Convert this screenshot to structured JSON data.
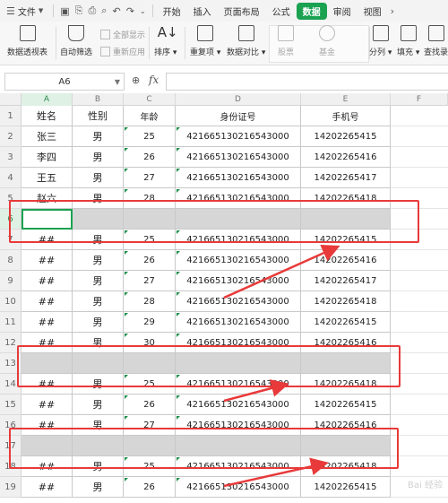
{
  "menubar": {
    "file_label": "文件",
    "tabs": [
      {
        "label": "开始",
        "active": false
      },
      {
        "label": "插入",
        "active": false
      },
      {
        "label": "页面布局",
        "active": false
      },
      {
        "label": "公式",
        "active": false
      },
      {
        "label": "数据",
        "active": true
      },
      {
        "label": "审阅",
        "active": false
      },
      {
        "label": "视图",
        "active": false
      }
    ]
  },
  "ribbon": {
    "pivot": "数据透视表",
    "autofilter": "自动筛选",
    "show_all": "全部显示",
    "reapply": "重新应用",
    "sort": "排序",
    "duplicates": "重复项",
    "compare": "数据对比",
    "stocks": "股票",
    "funds": "基金",
    "split": "分列",
    "fill": "填充",
    "find_record": "查找录"
  },
  "formula_bar": {
    "name_box": "A6",
    "fx_label": "fx",
    "formula_value": ""
  },
  "columns": [
    "A",
    "B",
    "C",
    "D",
    "E",
    "F"
  ],
  "row_numbers": [
    "1",
    "2",
    "3",
    "4",
    "5",
    "6",
    "7",
    "8",
    "9",
    "10",
    "11",
    "12",
    "13",
    "14",
    "15",
    "16",
    "17",
    "18",
    "19"
  ],
  "rows": [
    {
      "type": "header",
      "cells": [
        "姓名",
        "性别",
        "年龄",
        "身份证号",
        "手机号"
      ]
    },
    {
      "type": "data",
      "cells": [
        "张三",
        "男",
        "25",
        "421665130216543000",
        "14202265415"
      ]
    },
    {
      "type": "data",
      "cells": [
        "李四",
        "男",
        "26",
        "421665130216543000",
        "14202265416"
      ]
    },
    {
      "type": "data",
      "cells": [
        "王五",
        "男",
        "27",
        "421665130216543000",
        "14202265417"
      ]
    },
    {
      "type": "data",
      "cells": [
        "赵六",
        "男",
        "28",
        "421665130216543000",
        "14202265418"
      ]
    },
    {
      "type": "blank",
      "cells": [
        "",
        "",
        "",
        "",
        ""
      ]
    },
    {
      "type": "data",
      "cells": [
        "##",
        "男",
        "25",
        "421665130216543000",
        "14202265415"
      ]
    },
    {
      "type": "data",
      "cells": [
        "##",
        "男",
        "26",
        "421665130216543000",
        "14202265416"
      ]
    },
    {
      "type": "data",
      "cells": [
        "##",
        "男",
        "27",
        "421665130216543000",
        "14202265417"
      ]
    },
    {
      "type": "data",
      "cells": [
        "##",
        "男",
        "28",
        "421665130216543000",
        "14202265418"
      ]
    },
    {
      "type": "data",
      "cells": [
        "##",
        "男",
        "29",
        "421665130216543000",
        "14202265415"
      ]
    },
    {
      "type": "data",
      "cells": [
        "##",
        "男",
        "30",
        "421665130216543000",
        "14202265416"
      ]
    },
    {
      "type": "blank",
      "cells": [
        "",
        "",
        "",
        "",
        ""
      ]
    },
    {
      "type": "data",
      "cells": [
        "##",
        "男",
        "25",
        "421665130216543000",
        "14202265418"
      ]
    },
    {
      "type": "data",
      "cells": [
        "##",
        "男",
        "26",
        "421665130216543000",
        "14202265415"
      ]
    },
    {
      "type": "data",
      "cells": [
        "##",
        "男",
        "27",
        "421665130216543000",
        "14202265416"
      ]
    },
    {
      "type": "blank",
      "cells": [
        "",
        "",
        "",
        "",
        ""
      ]
    },
    {
      "type": "data",
      "cells": [
        "##",
        "男",
        "25",
        "421665130216543000",
        "14202265418"
      ]
    },
    {
      "type": "data",
      "cells": [
        "##",
        "男",
        "26",
        "421665130216543000",
        "14202265415"
      ]
    }
  ],
  "watermark": "Bai 经验"
}
